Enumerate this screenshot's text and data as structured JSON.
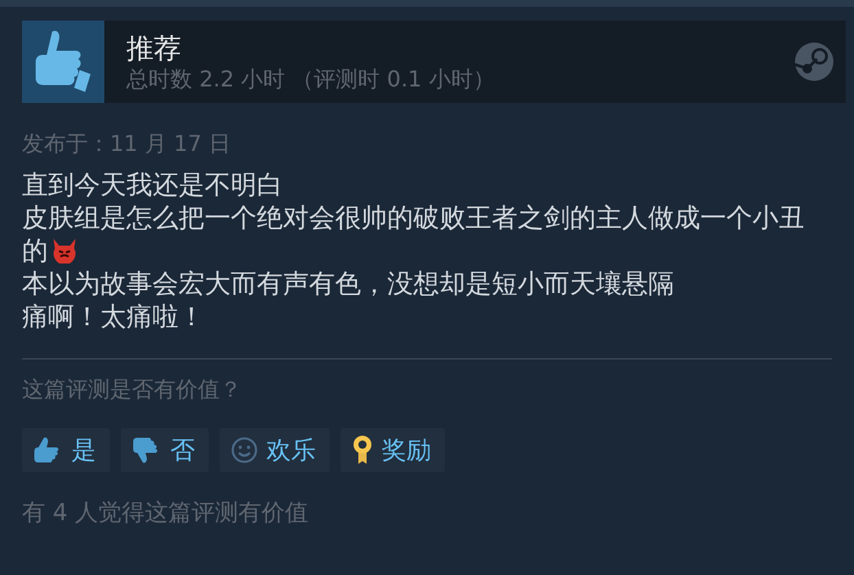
{
  "review": {
    "verdict": "推荐",
    "playtime": "总时数 2.2 小时 （评测时 0.1 小时）",
    "posted": "发布于：11 月 17 日",
    "lines": [
      {
        "text": "直到今天我还是不明白",
        "emoji": false
      },
      {
        "text": "皮肤组是怎么把一个绝对会很帅的破败王者之剑的主人做成一个小丑的",
        "emoji": true
      },
      {
        "text": "本以为故事会宏大而有声有色，没想却是短小而天壤悬隔",
        "emoji": false
      },
      {
        "text": "痛啊！太痛啦！",
        "emoji": false
      }
    ]
  },
  "helpful": {
    "question": "这篇评测是否有价值？",
    "buttons": [
      {
        "kind": "yes",
        "label": "是"
      },
      {
        "kind": "no",
        "label": "否"
      },
      {
        "kind": "funny",
        "label": "欢乐"
      },
      {
        "kind": "award",
        "label": "奖励"
      }
    ],
    "summary": "有 4 人觉得这篇评测有价值"
  }
}
